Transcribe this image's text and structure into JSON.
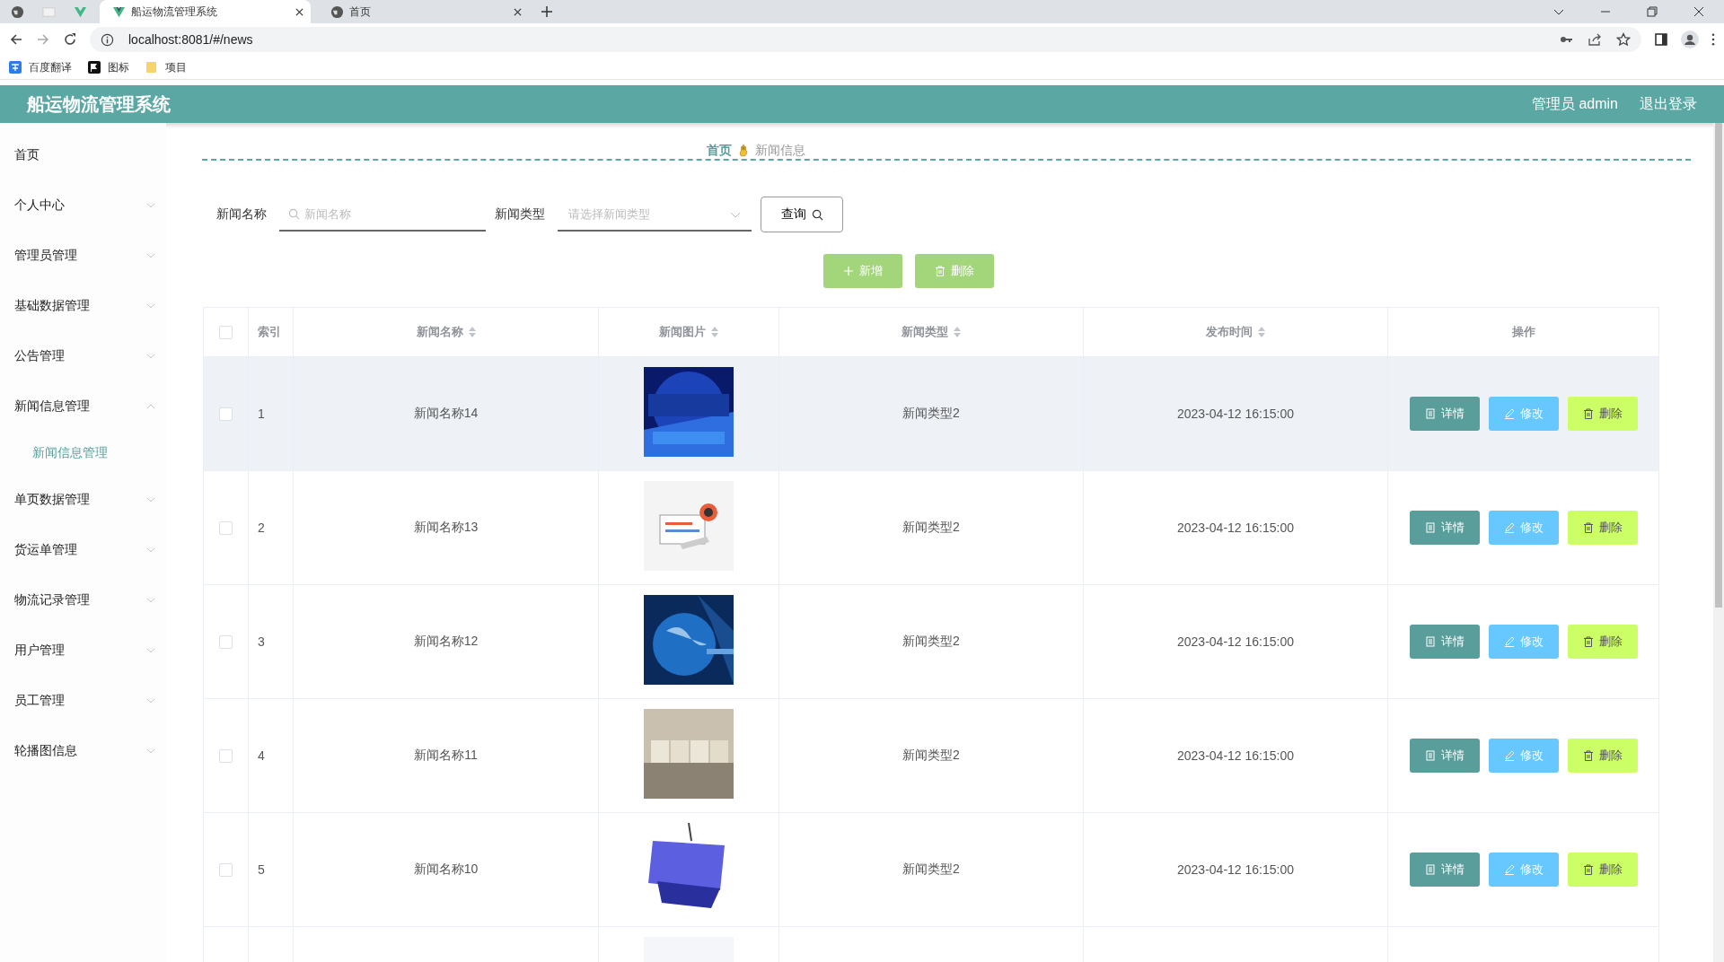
{
  "browser": {
    "tabs": [
      {
        "title": "船运物流管理系统",
        "selected": true
      },
      {
        "title": "首页",
        "selected": false
      }
    ],
    "url": "localhost:8081/#/news",
    "bookmarks": [
      {
        "label": "百度翻译"
      },
      {
        "label": "图标"
      },
      {
        "label": "项目"
      }
    ]
  },
  "app": {
    "title": "船运物流管理系统",
    "user": "管理员 admin",
    "logout": "退出登录"
  },
  "sidebar": {
    "items": [
      {
        "label": "首页",
        "kind": "link"
      },
      {
        "label": "个人中心",
        "kind": "group",
        "expanded": false
      },
      {
        "label": "管理员管理",
        "kind": "group",
        "expanded": false
      },
      {
        "label": "基础数据管理",
        "kind": "group",
        "expanded": false
      },
      {
        "label": "公告管理",
        "kind": "group",
        "expanded": false
      },
      {
        "label": "新闻信息管理",
        "kind": "group",
        "expanded": true,
        "children": [
          {
            "label": "新闻信息管理",
            "selected": true
          }
        ]
      },
      {
        "label": "单页数据管理",
        "kind": "group",
        "expanded": false
      },
      {
        "label": "货运单管理",
        "kind": "group",
        "expanded": false
      },
      {
        "label": "物流记录管理",
        "kind": "group",
        "expanded": false
      },
      {
        "label": "用户管理",
        "kind": "group",
        "expanded": false
      },
      {
        "label": "员工管理",
        "kind": "group",
        "expanded": false
      },
      {
        "label": "轮播图信息",
        "kind": "group",
        "expanded": false
      }
    ]
  },
  "breadcrumb": [
    "首页",
    "新闻信息"
  ],
  "filters": [
    {
      "kind": "text",
      "label": "新闻名称",
      "placeholder": "新闻名称"
    },
    {
      "kind": "select",
      "label": "新闻类型",
      "placeholder": "请选择新闻类型"
    }
  ],
  "query_button": "查询",
  "toolbar": [
    {
      "kind": "add",
      "label": "新增"
    },
    {
      "kind": "delete",
      "label": "删除"
    }
  ],
  "table": {
    "all_checked": false,
    "columns": [
      {
        "label": "索引",
        "sortable": false
      },
      {
        "label": "新闻名称",
        "sortable": true
      },
      {
        "label": "新闻图片",
        "sortable": true
      },
      {
        "label": "新闻类型",
        "sortable": true
      },
      {
        "label": "发布时间",
        "sortable": true
      },
      {
        "label": "操作",
        "sortable": false
      }
    ],
    "rows": [
      {
        "index": "1",
        "name": "新闻名称14",
        "type": "新闻类型2",
        "time": "2023-04-12 16:15:00",
        "hovered": true,
        "checked": false,
        "actions": [
          {
            "kind": "detail",
            "label": "详情"
          },
          {
            "kind": "edit",
            "label": "修改"
          },
          {
            "kind": "delete",
            "label": "删除"
          }
        ]
      },
      {
        "index": "2",
        "name": "新闻名称13",
        "type": "新闻类型2",
        "time": "2023-04-12 16:15:00",
        "hovered": false,
        "checked": false,
        "actions": [
          {
            "kind": "detail",
            "label": "详情"
          },
          {
            "kind": "edit",
            "label": "修改"
          },
          {
            "kind": "delete",
            "label": "删除"
          }
        ]
      },
      {
        "index": "3",
        "name": "新闻名称12",
        "type": "新闻类型2",
        "time": "2023-04-12 16:15:00",
        "hovered": false,
        "checked": false,
        "actions": [
          {
            "kind": "detail",
            "label": "详情"
          },
          {
            "kind": "edit",
            "label": "修改"
          },
          {
            "kind": "delete",
            "label": "删除"
          }
        ]
      },
      {
        "index": "4",
        "name": "新闻名称11",
        "type": "新闻类型2",
        "time": "2023-04-12 16:15:00",
        "hovered": false,
        "checked": false,
        "actions": [
          {
            "kind": "detail",
            "label": "详情"
          },
          {
            "kind": "edit",
            "label": "修改"
          },
          {
            "kind": "delete",
            "label": "删除"
          }
        ]
      },
      {
        "index": "5",
        "name": "新闻名称10",
        "type": "新闻类型2",
        "time": "2023-04-12 16:15:00",
        "hovered": false,
        "checked": false,
        "actions": [
          {
            "kind": "detail",
            "label": "详情"
          },
          {
            "kind": "edit",
            "label": "修改"
          },
          {
            "kind": "delete",
            "label": "删除"
          }
        ]
      },
      {
        "hovered": false
      }
    ]
  }
}
